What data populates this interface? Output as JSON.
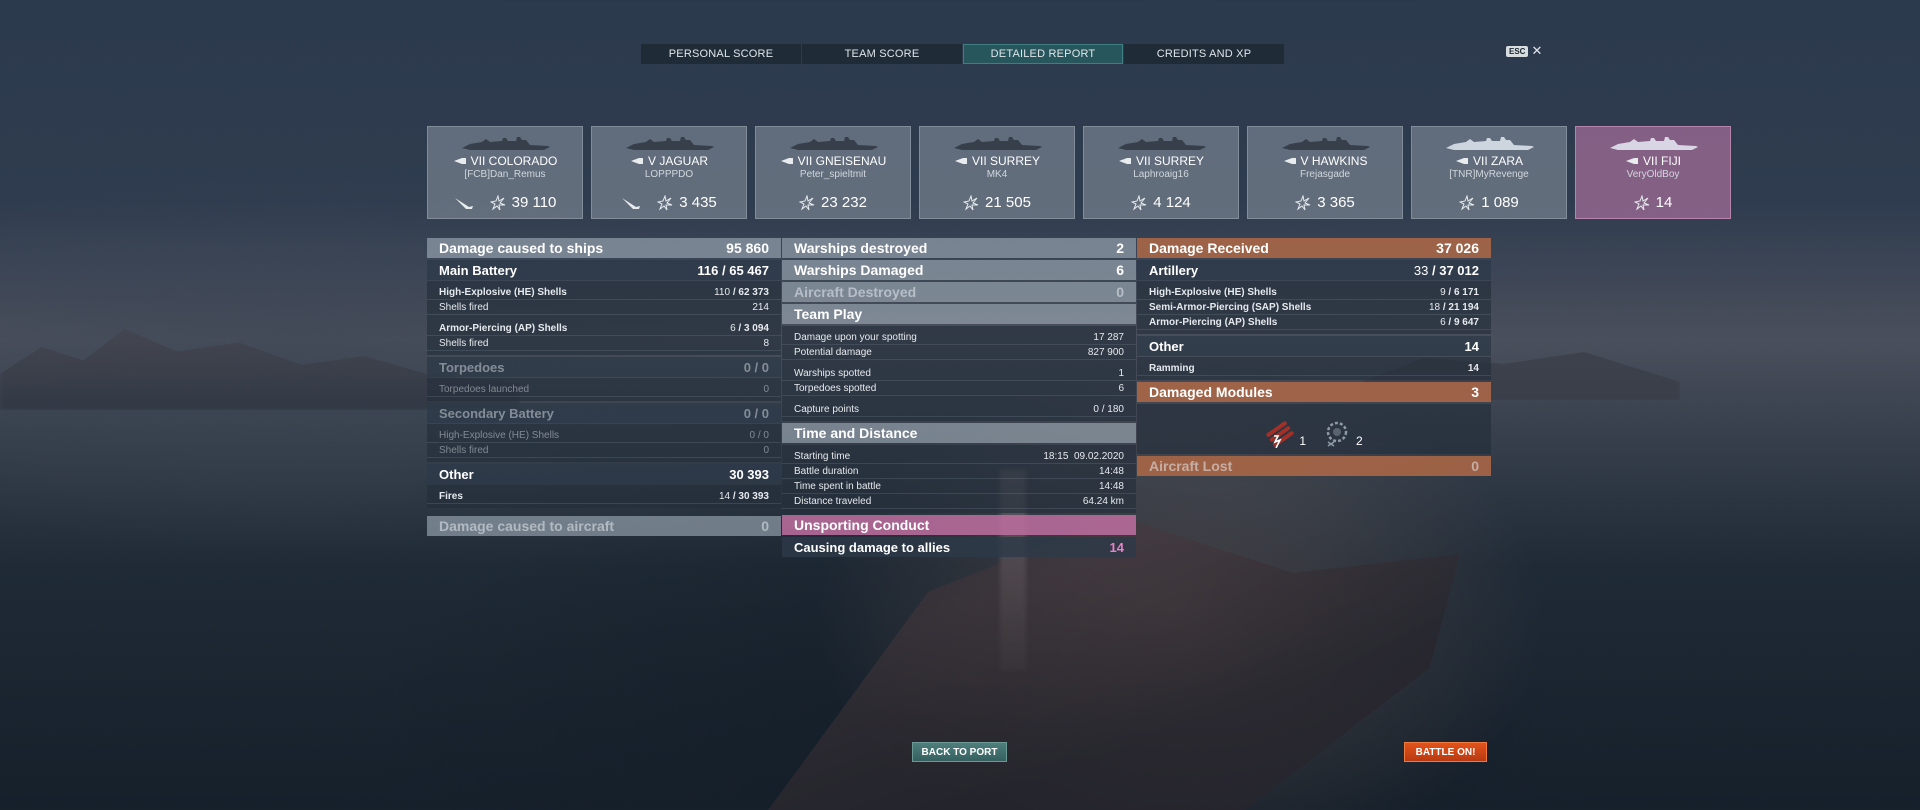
{
  "tabs": [
    {
      "label": "PERSONAL SCORE",
      "active": false
    },
    {
      "label": "TEAM SCORE",
      "active": false
    },
    {
      "label": "DETAILED REPORT",
      "active": true
    },
    {
      "label": "CREDITS AND XP",
      "active": false
    }
  ],
  "esc": {
    "key": "ESC",
    "icon": "close-icon"
  },
  "ships": [
    {
      "name": "VII COLORADO",
      "player": "[FCB]Dan_Remus",
      "score": "39 110",
      "destroyed": true,
      "class": "battleship"
    },
    {
      "name": "V JAGUAR",
      "player": "LOPPPDO",
      "score": "3 435",
      "destroyed": true,
      "class": "destroyer"
    },
    {
      "name": "VII GNEISENAU",
      "player": "Peter_spieltmit",
      "score": "23 232",
      "destroyed": false,
      "class": "battleship"
    },
    {
      "name": "VII SURREY",
      "player": "MK4",
      "score": "21 505",
      "destroyed": false,
      "class": "cruiser"
    },
    {
      "name": "VII SURREY",
      "player": "Laphroaig16",
      "score": "4 124",
      "destroyed": false,
      "class": "cruiser"
    },
    {
      "name": "V HAWKINS",
      "player": "Frejasgade",
      "score": "3 365",
      "destroyed": false,
      "class": "cruiser"
    },
    {
      "name": "VII ZARA",
      "player": "[TNR]MyRevenge",
      "score": "1 089",
      "destroyed": false,
      "class": "cruiser"
    },
    {
      "name": "VII FIJI",
      "player": "VeryOldBoy",
      "score": "14",
      "destroyed": false,
      "class": "cruiser",
      "me": true
    }
  ],
  "left": {
    "damage_ships": {
      "label": "Damage caused to ships",
      "value": "95 860"
    },
    "main_battery": {
      "label": "Main Battery",
      "hits": "116",
      "total": "65 467"
    },
    "he": {
      "label": "High-Explosive (HE) Shells",
      "hits": "110",
      "dmg": "62 373"
    },
    "he_fired": {
      "label": "Shells fired",
      "value": "214"
    },
    "ap": {
      "label": "Armor-Piercing (AP) Shells",
      "hits": "6",
      "dmg": "3 094"
    },
    "ap_fired": {
      "label": "Shells fired",
      "value": "8"
    },
    "torpedoes": {
      "label": "Torpedoes",
      "value": "0 / 0"
    },
    "torp_launched": {
      "label": "Torpedoes launched",
      "value": "0"
    },
    "secondary": {
      "label": "Secondary Battery",
      "value": "0 / 0"
    },
    "sec_he": {
      "label": "High-Explosive (HE) Shells",
      "value": "0 / 0"
    },
    "sec_fired": {
      "label": "Shells fired",
      "value": "0"
    },
    "other": {
      "label": "Other",
      "value": "30 393"
    },
    "fires": {
      "label": "Fires",
      "hits": "14",
      "dmg": "30 393"
    },
    "damage_aircraft": {
      "label": "Damage caused to aircraft",
      "value": "0"
    }
  },
  "mid": {
    "warships_destroyed": {
      "label": "Warships destroyed",
      "value": "2"
    },
    "warships_damaged": {
      "label": "Warships Damaged",
      "value": "6"
    },
    "aircraft_destroyed": {
      "label": "Aircraft Destroyed",
      "value": "0"
    },
    "team_play": {
      "label": "Team Play"
    },
    "spotting_dmg": {
      "label": "Damage upon your spotting",
      "value": "17 287"
    },
    "potential": {
      "label": "Potential damage",
      "value": "827 900"
    },
    "ws_spotted": {
      "label": "Warships spotted",
      "value": "1"
    },
    "torp_spotted": {
      "label": "Torpedoes spotted",
      "value": "6"
    },
    "capture": {
      "label": "Capture points",
      "value": "0 / 180"
    },
    "time_distance": {
      "label": "Time and Distance"
    },
    "start": {
      "label": "Starting time",
      "value": "18:15  09.02.2020"
    },
    "duration": {
      "label": "Battle duration",
      "value": "14:48"
    },
    "time_spent": {
      "label": "Time spent in battle",
      "value": "14:48"
    },
    "distance": {
      "label": "Distance traveled",
      "value": "64.24 km"
    },
    "unsporting": {
      "label": "Unsporting Conduct"
    },
    "allies_dmg": {
      "label": "Causing damage to allies",
      "value": "14"
    }
  },
  "right": {
    "damage_received": {
      "label": "Damage Received",
      "value": "37 026"
    },
    "artillery": {
      "label": "Artillery",
      "hits": "33",
      "total": "37 012"
    },
    "he": {
      "label": "High-Explosive (HE) Shells",
      "hits": "9",
      "dmg": "6 171"
    },
    "sap": {
      "label": "Semi-Armor-Piercing (SAP) Shells",
      "hits": "18",
      "dmg": "21 194"
    },
    "ap": {
      "label": "Armor-Piercing (AP) Shells",
      "hits": "6",
      "dmg": "9 647"
    },
    "other": {
      "label": "Other",
      "value": "14"
    },
    "ramming": {
      "label": "Ramming",
      "value": "14"
    },
    "modules": {
      "label": "Damaged Modules",
      "value": "3"
    },
    "module_items": [
      {
        "icon": "torpedo-tubes-icon",
        "count": "1"
      },
      {
        "icon": "engine-icon",
        "count": "2"
      }
    ],
    "aircraft_lost": {
      "label": "Aircraft Lost",
      "value": "0"
    }
  },
  "buttons": {
    "back": "BACK TO PORT",
    "battle": "BATTLE ON!"
  },
  "colors": {
    "accent_teal": "#3f7f84",
    "battle_orange": "#e2531c",
    "received_orange": "#af6946",
    "pink": "#be6ea0"
  }
}
